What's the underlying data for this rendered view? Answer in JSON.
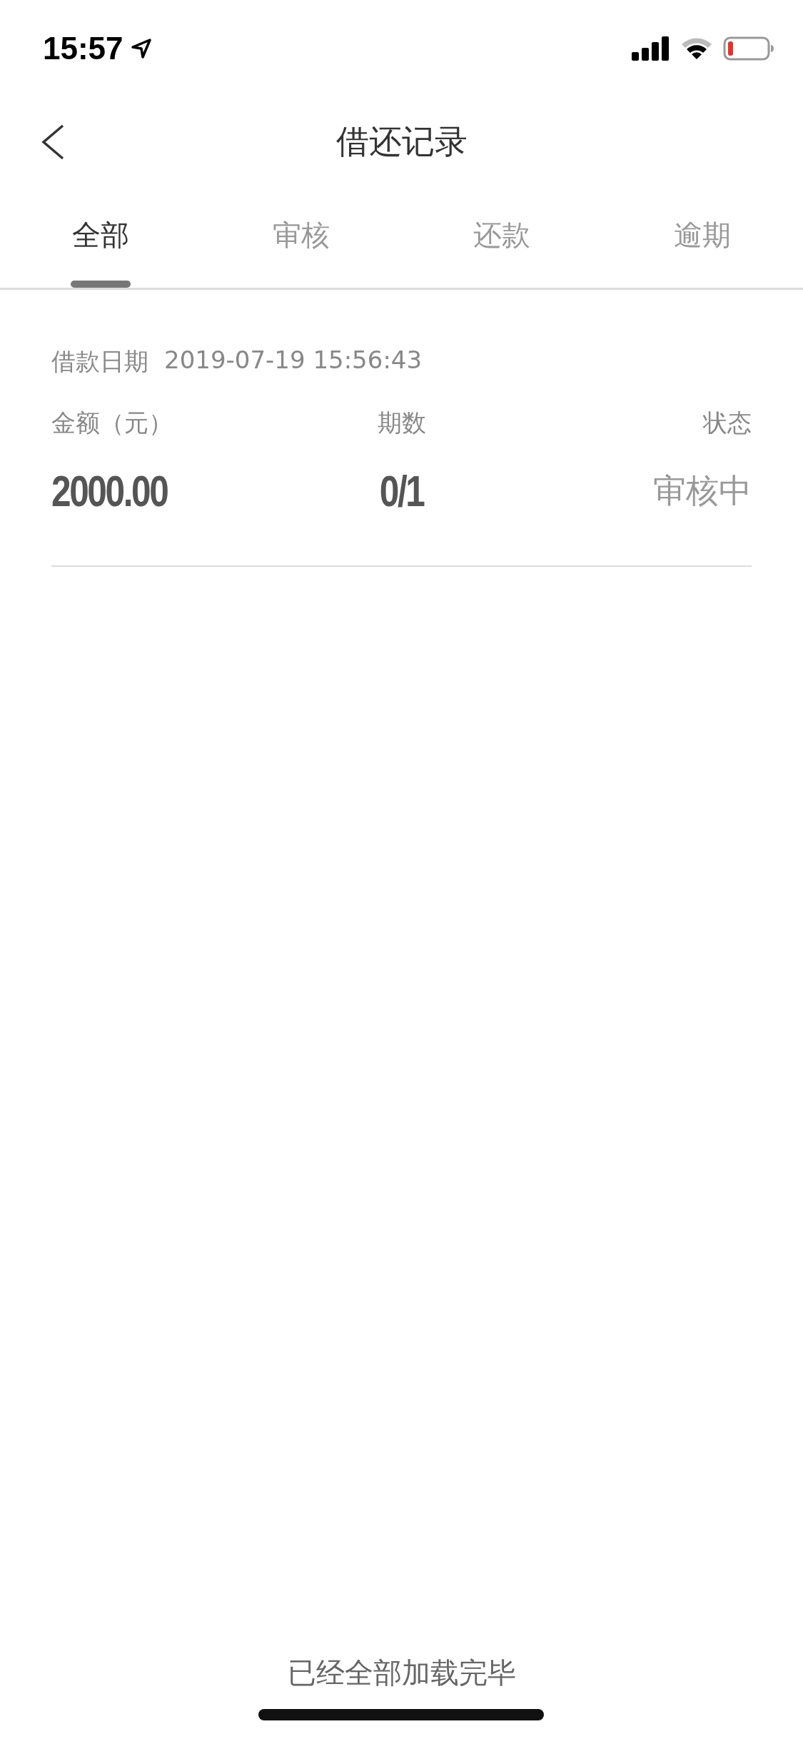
{
  "status_bar": {
    "time": "15:57"
  },
  "nav": {
    "title": "借还记录"
  },
  "tabs": [
    {
      "label": "全部",
      "selected": true
    },
    {
      "label": "审核",
      "selected": false
    },
    {
      "label": "还款",
      "selected": false
    },
    {
      "label": "逾期",
      "selected": false
    }
  ],
  "records": [
    {
      "date_label": "借款日期",
      "date": "2019-07-19 15:56:43",
      "amount_label": "金额（元）",
      "amount": "2000.00",
      "term_label": "期数",
      "term": "0/1",
      "status_label": "状态",
      "status": "审核中"
    }
  ],
  "footer": "已经全部加载完毕"
}
